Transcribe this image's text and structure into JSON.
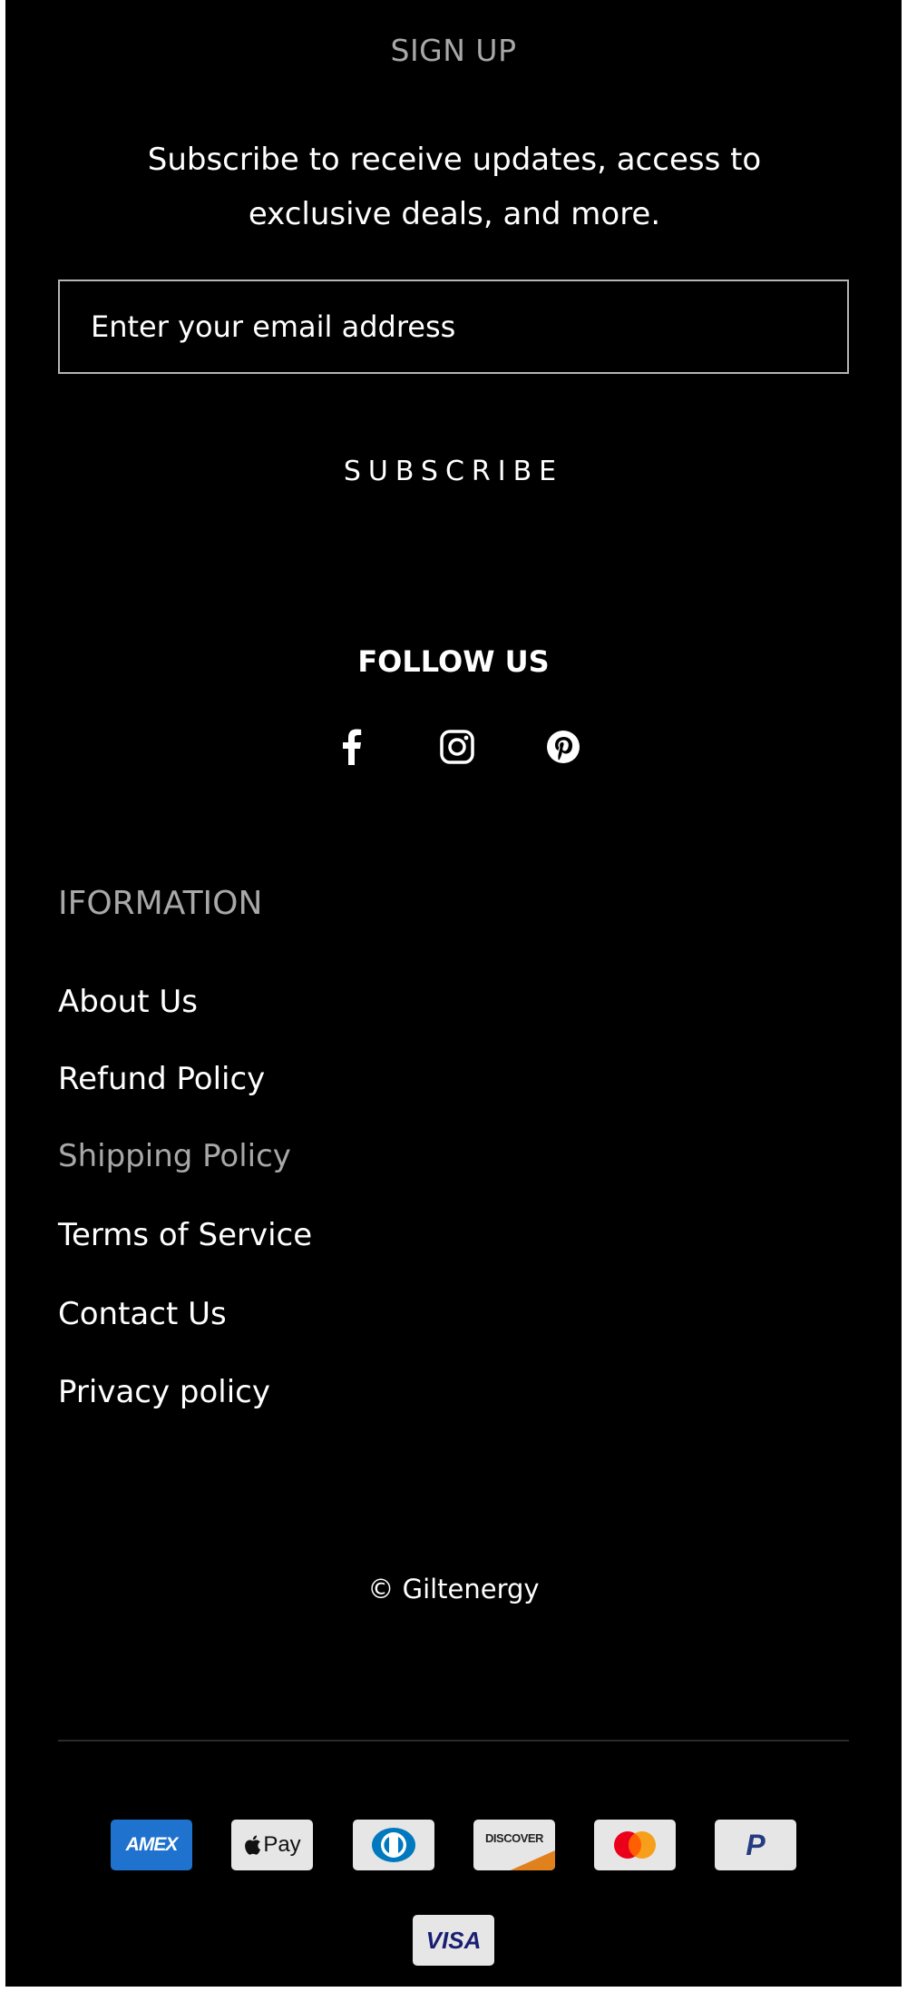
{
  "signup": {
    "title": "SIGN UP",
    "description": "Subscribe to receive updates, access to exclusive deals, and more.",
    "email_placeholder": "Enter your email address",
    "subscribe_label": "SUBSCRIBE"
  },
  "follow": {
    "title": "FOLLOW US",
    "icons": [
      "facebook-icon",
      "instagram-icon",
      "pinterest-icon"
    ]
  },
  "information": {
    "title": "IFORMATION",
    "links": [
      "About Us",
      "Refund Policy",
      "Shipping Policy",
      "Terms of Service",
      "Contact Us",
      "Privacy policy"
    ]
  },
  "footer": {
    "copyright": "© Giltenergy"
  },
  "payments": {
    "amex": "AMEX",
    "applepay": "Pay",
    "discover": "DISCOVER",
    "paypal": "P",
    "visa": "VISA",
    "icons": [
      "amex-icon",
      "apple-pay-icon",
      "diners-club-icon",
      "discover-icon",
      "mastercard-icon",
      "paypal-icon",
      "visa-icon"
    ]
  },
  "colors": {
    "background": "#000000",
    "muted_text": "#a8a8a8",
    "amex_blue": "#1f72cd",
    "discover_orange": "#e1811d",
    "mastercard_red": "#eb001b",
    "mastercard_orange": "#f79e1b",
    "paypal_blue": "#253b80",
    "visa_blue": "#1a1f71"
  }
}
